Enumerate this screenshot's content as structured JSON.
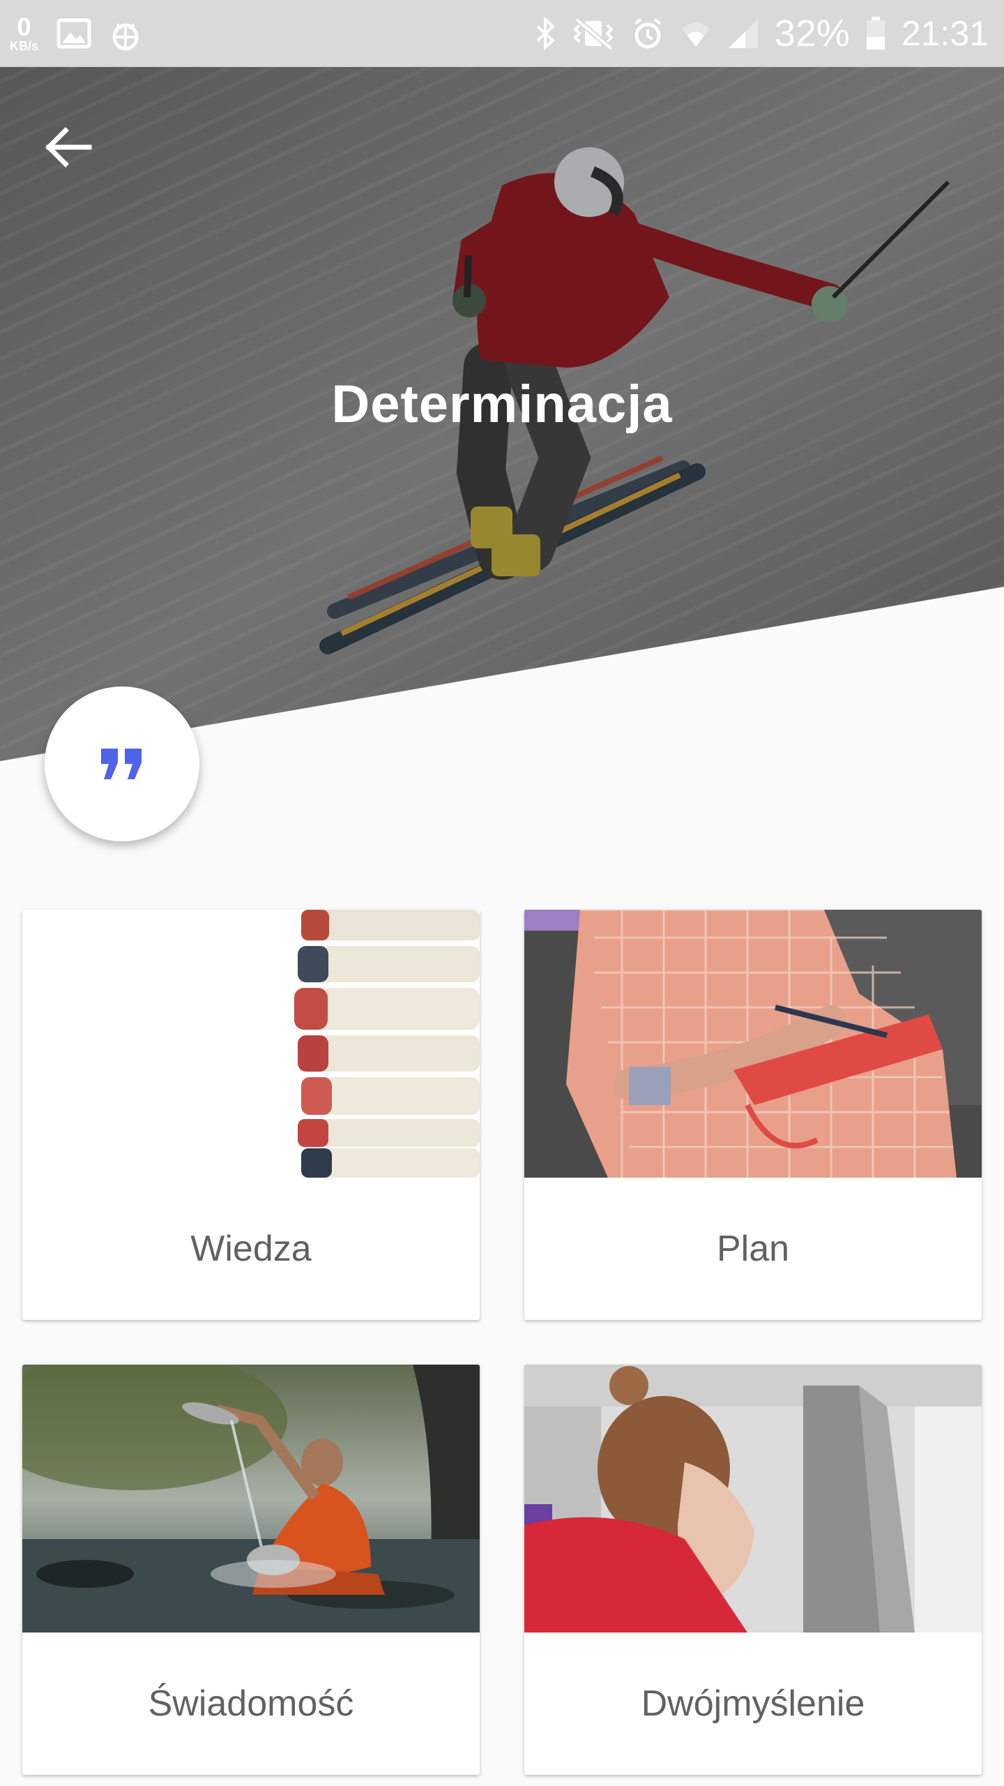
{
  "status_bar": {
    "net_speed_value": "0",
    "net_speed_unit": "KB/s",
    "battery_percent": "32%",
    "time": "21:31",
    "icons": [
      "image-icon",
      "bug-icon",
      "bluetooth-icon",
      "vibrate-icon",
      "alarm-icon",
      "wifi-icon",
      "signal-icon",
      "battery-icon"
    ]
  },
  "header": {
    "back_icon": "arrow-left-icon",
    "title": "Determinacja"
  },
  "quote_button": {
    "icon": "quote-icon",
    "accent_color": "#4f63e8"
  },
  "cards": [
    {
      "label": "Wiedza",
      "image": "stack-of-books"
    },
    {
      "label": "Plan",
      "image": "person-writing-in-notebook"
    },
    {
      "label": "Świadomość",
      "image": "monk-pouring-water-in-river"
    },
    {
      "label": "Dwójmyślenie",
      "image": "woman-reading"
    }
  ]
}
